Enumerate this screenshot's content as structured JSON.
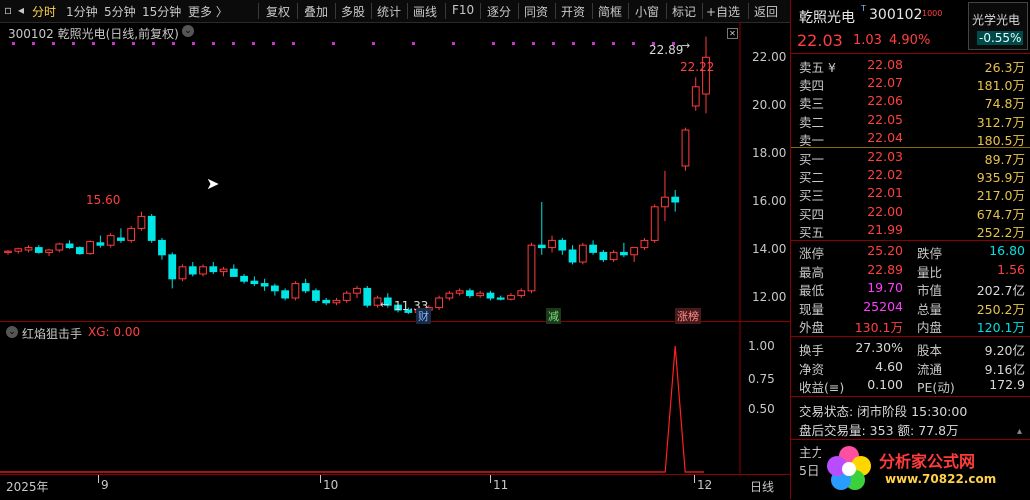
{
  "toolbar": {
    "left_items": [
      "分时",
      "1分钟",
      "5分钟",
      "15分钟",
      "更多 〉"
    ],
    "right_items": [
      "复权",
      "叠加",
      "多股",
      "统计",
      "画线",
      "F10",
      "逐分",
      "同资",
      "开资",
      "简框",
      "小窗",
      "标记",
      "+自选",
      "返回"
    ]
  },
  "main_chart": {
    "title": "300102 乾照光电(日线,前复权)",
    "y_ticks": [
      "22.00",
      "20.00",
      "18.00",
      "16.00",
      "14.00",
      "12.00"
    ],
    "annotations": {
      "high_label": "15.60",
      "low_label": "11.33",
      "top_label": "22.89",
      "top_red_label": "22.22"
    },
    "markers": [
      "财",
      "减",
      "涨榜"
    ]
  },
  "indicator": {
    "name": "红焰狙击手",
    "value_label": "XG: 0.00",
    "y_ticks": [
      "1.00",
      "0.75",
      "0.50"
    ]
  },
  "x_axis": {
    "labels": [
      "2025年",
      "9",
      "10",
      "11",
      "12"
    ],
    "right_label": "日线"
  },
  "chart_data": {
    "type": "candlestick",
    "ohlc": [
      [
        13.9,
        14.0,
        13.8,
        13.95
      ],
      [
        13.95,
        14.1,
        13.85,
        14.05
      ],
      [
        14.0,
        14.2,
        13.9,
        14.1
      ],
      [
        14.1,
        14.2,
        13.85,
        13.9
      ],
      [
        13.9,
        14.05,
        13.75,
        14.0
      ],
      [
        14.0,
        14.3,
        13.9,
        14.25
      ],
      [
        14.25,
        14.4,
        14.05,
        14.1
      ],
      [
        14.1,
        14.15,
        13.8,
        13.85
      ],
      [
        13.85,
        14.4,
        13.8,
        14.35
      ],
      [
        14.3,
        14.6,
        14.1,
        14.2
      ],
      [
        14.2,
        14.7,
        14.1,
        14.6
      ],
      [
        14.5,
        14.9,
        14.3,
        14.4
      ],
      [
        14.4,
        15.0,
        14.3,
        14.9
      ],
      [
        14.9,
        15.6,
        14.8,
        15.4
      ],
      [
        15.4,
        15.5,
        14.3,
        14.4
      ],
      [
        14.4,
        14.5,
        13.6,
        13.8
      ],
      [
        13.8,
        13.9,
        12.4,
        12.8
      ],
      [
        12.8,
        13.4,
        12.7,
        13.3
      ],
      [
        13.3,
        13.5,
        12.9,
        13.0
      ],
      [
        13.0,
        13.4,
        12.9,
        13.3
      ],
      [
        13.3,
        13.5,
        13.0,
        13.1
      ],
      [
        13.1,
        13.3,
        12.9,
        13.2
      ],
      [
        13.2,
        13.4,
        12.9,
        12.9
      ],
      [
        12.9,
        13.0,
        12.6,
        12.7
      ],
      [
        12.7,
        12.9,
        12.5,
        12.6
      ],
      [
        12.6,
        12.8,
        12.3,
        12.5
      ],
      [
        12.5,
        12.6,
        12.1,
        12.3
      ],
      [
        12.3,
        12.4,
        11.9,
        12.0
      ],
      [
        12.0,
        12.7,
        11.9,
        12.6
      ],
      [
        12.6,
        12.8,
        12.2,
        12.3
      ],
      [
        12.3,
        12.4,
        11.8,
        11.9
      ],
      [
        11.9,
        12.0,
        11.7,
        11.8
      ],
      [
        11.8,
        12.0,
        11.7,
        11.9
      ],
      [
        11.9,
        12.3,
        11.8,
        12.2
      ],
      [
        12.2,
        12.5,
        12.0,
        12.4
      ],
      [
        12.4,
        12.5,
        11.6,
        11.7
      ],
      [
        11.7,
        12.1,
        11.6,
        12.0
      ],
      [
        12.0,
        12.2,
        11.6,
        11.7
      ],
      [
        11.7,
        11.8,
        11.4,
        11.5
      ],
      [
        11.5,
        11.6,
        11.33,
        11.4
      ],
      [
        11.4,
        11.6,
        11.35,
        11.5
      ],
      [
        11.5,
        11.7,
        11.4,
        11.6
      ],
      [
        11.6,
        12.1,
        11.5,
        12.0
      ],
      [
        12.0,
        12.3,
        11.9,
        12.2
      ],
      [
        12.2,
        12.4,
        12.1,
        12.3
      ],
      [
        12.3,
        12.4,
        12.0,
        12.1
      ],
      [
        12.1,
        12.3,
        12.0,
        12.2
      ],
      [
        12.2,
        12.3,
        11.9,
        12.0
      ],
      [
        12.0,
        12.1,
        11.9,
        11.95
      ],
      [
        11.95,
        12.2,
        11.9,
        12.1
      ],
      [
        12.1,
        12.4,
        12.0,
        12.3
      ],
      [
        12.3,
        14.3,
        12.2,
        14.2
      ],
      [
        14.2,
        16.0,
        13.8,
        14.1
      ],
      [
        14.1,
        14.6,
        13.9,
        14.4
      ],
      [
        14.4,
        14.5,
        13.8,
        14.0
      ],
      [
        14.0,
        14.2,
        13.4,
        13.5
      ],
      [
        13.5,
        14.3,
        13.4,
        14.2
      ],
      [
        14.2,
        14.4,
        13.8,
        13.9
      ],
      [
        13.9,
        14.0,
        13.5,
        13.6
      ],
      [
        13.6,
        14.0,
        13.5,
        13.9
      ],
      [
        13.9,
        14.3,
        13.7,
        13.8
      ],
      [
        13.8,
        14.1,
        13.5,
        14.1
      ],
      [
        14.1,
        14.5,
        14.0,
        14.4
      ],
      [
        14.4,
        15.9,
        14.3,
        15.8
      ],
      [
        15.8,
        17.3,
        15.2,
        16.2
      ],
      [
        16.2,
        16.5,
        15.6,
        16.0
      ],
      [
        17.5,
        19.1,
        17.3,
        19.0
      ],
      [
        20.0,
        21.2,
        19.8,
        20.8
      ],
      [
        20.5,
        22.89,
        19.7,
        22.03
      ]
    ],
    "ylim": [
      11.0,
      23.5
    ],
    "signal": {
      "peak_index": 65,
      "value": 1.0
    }
  },
  "panel": {
    "name": "乾照光电",
    "name_sup": "T",
    "code": "300102",
    "code_sup": "1000",
    "sector": "光学光电",
    "sector_change": "-0.55%",
    "price": "22.03",
    "change": "1.03",
    "change_pct": "4.90%",
    "asks": [
      {
        "label": "卖五 ¥",
        "price": "22.08",
        "vol": "26.3万"
      },
      {
        "label": "卖四",
        "price": "22.07",
        "vol": "181.0万"
      },
      {
        "label": "卖三",
        "price": "22.06",
        "vol": "74.8万"
      },
      {
        "label": "卖二",
        "price": "22.05",
        "vol": "312.7万"
      },
      {
        "label": "卖一",
        "price": "22.04",
        "vol": "180.5万"
      }
    ],
    "bids": [
      {
        "label": "买一",
        "price": "22.03",
        "vol": "89.7万"
      },
      {
        "label": "买二",
        "price": "22.02",
        "vol": "935.9万"
      },
      {
        "label": "买三",
        "price": "22.01",
        "vol": "217.0万"
      },
      {
        "label": "买四",
        "price": "22.00",
        "vol": "674.7万"
      },
      {
        "label": "买五",
        "price": "21.99",
        "vol": "252.2万"
      }
    ],
    "stats1": [
      [
        "涨停",
        "25.20",
        "跌停",
        "16.80"
      ],
      [
        "最高",
        "22.89",
        "量比",
        "1.56"
      ],
      [
        "最低",
        "19.70",
        "市值",
        "202.7亿"
      ],
      [
        "现量",
        "25204",
        "总量",
        "250.2万"
      ],
      [
        "外盘",
        "130.1万",
        "内盘",
        "120.1万"
      ]
    ],
    "stats2": [
      [
        "换手",
        "27.30%",
        "股本",
        "9.20亿"
      ],
      [
        "净资",
        "4.60",
        "流通",
        "9.16亿"
      ],
      [
        "收益(≡)",
        "0.100",
        "PE(动)",
        "172.9"
      ]
    ],
    "trade_state": "交易状态: 闭市阶段 15:30:00",
    "after_hours": "盘后交易量: 353  额: 77.8万",
    "bottom_labels": [
      "主力",
      "5日"
    ],
    "logo_text": "分析家公式网",
    "logo_url": "www.70822.com"
  }
}
